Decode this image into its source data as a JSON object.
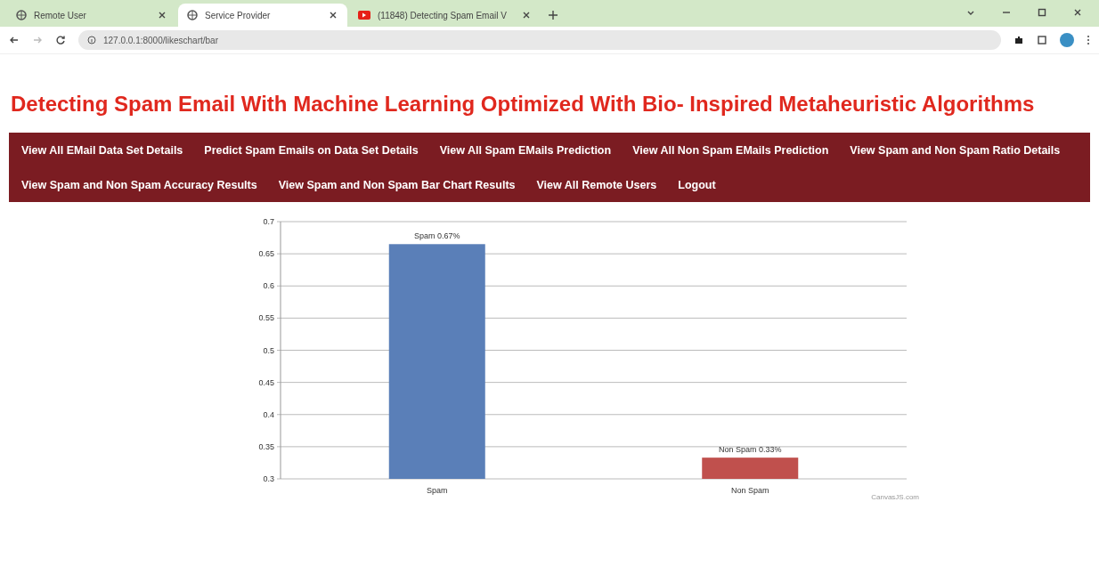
{
  "browser": {
    "tabs": [
      {
        "title": "Remote User",
        "selected": false,
        "kind": "globe"
      },
      {
        "title": "Service Provider",
        "selected": true,
        "kind": "globe"
      },
      {
        "title": "(11848) Detecting Spam Email V",
        "selected": false,
        "kind": "video"
      }
    ],
    "url": "127.0.0.1:8000/likeschart/bar"
  },
  "title": "Detecting Spam Email With Machine Learning Optimized With Bio- Inspired Metaheuristic Algorithms",
  "nav": [
    "View All EMail Data Set Details",
    "Predict Spam Emails on Data Set Details",
    "View All Spam EMails Prediction",
    "View All Non Spam EMails Prediction",
    "View Spam and Non Spam Ratio Details",
    "View Spam and Non Spam Accuracy Results",
    "View Spam and Non Spam Bar Chart Results",
    "View All Remote Users",
    "Logout"
  ],
  "chart": {
    "chart_data": {
      "type": "bar",
      "grid": true,
      "categories": [
        "Spam",
        "Non Spam"
      ],
      "series": [
        {
          "color": "#5a7fb8",
          "values": [
            0.665,
            null
          ]
        },
        {
          "color": "#c0504d",
          "values": [
            null,
            0.333
          ]
        }
      ],
      "value_labels": [
        "Spam 0.67%",
        "Non Spam 0.33%"
      ],
      "ylim": [
        0.3,
        0.7
      ],
      "yticks": [
        {
          "value": 0.3,
          "label": "0.3"
        },
        {
          "value": 0.35,
          "label": "0.35"
        },
        {
          "value": 0.4,
          "label": "0.4"
        },
        {
          "value": 0.45,
          "label": "0.45"
        },
        {
          "value": 0.5,
          "label": "0.5"
        },
        {
          "value": 0.55,
          "label": "0.55"
        },
        {
          "value": 0.6,
          "label": "0.6"
        },
        {
          "value": 0.65,
          "label": "0.65"
        },
        {
          "value": 0.7,
          "label": "0.7"
        }
      ]
    },
    "credit": "CanvasJS.com"
  }
}
